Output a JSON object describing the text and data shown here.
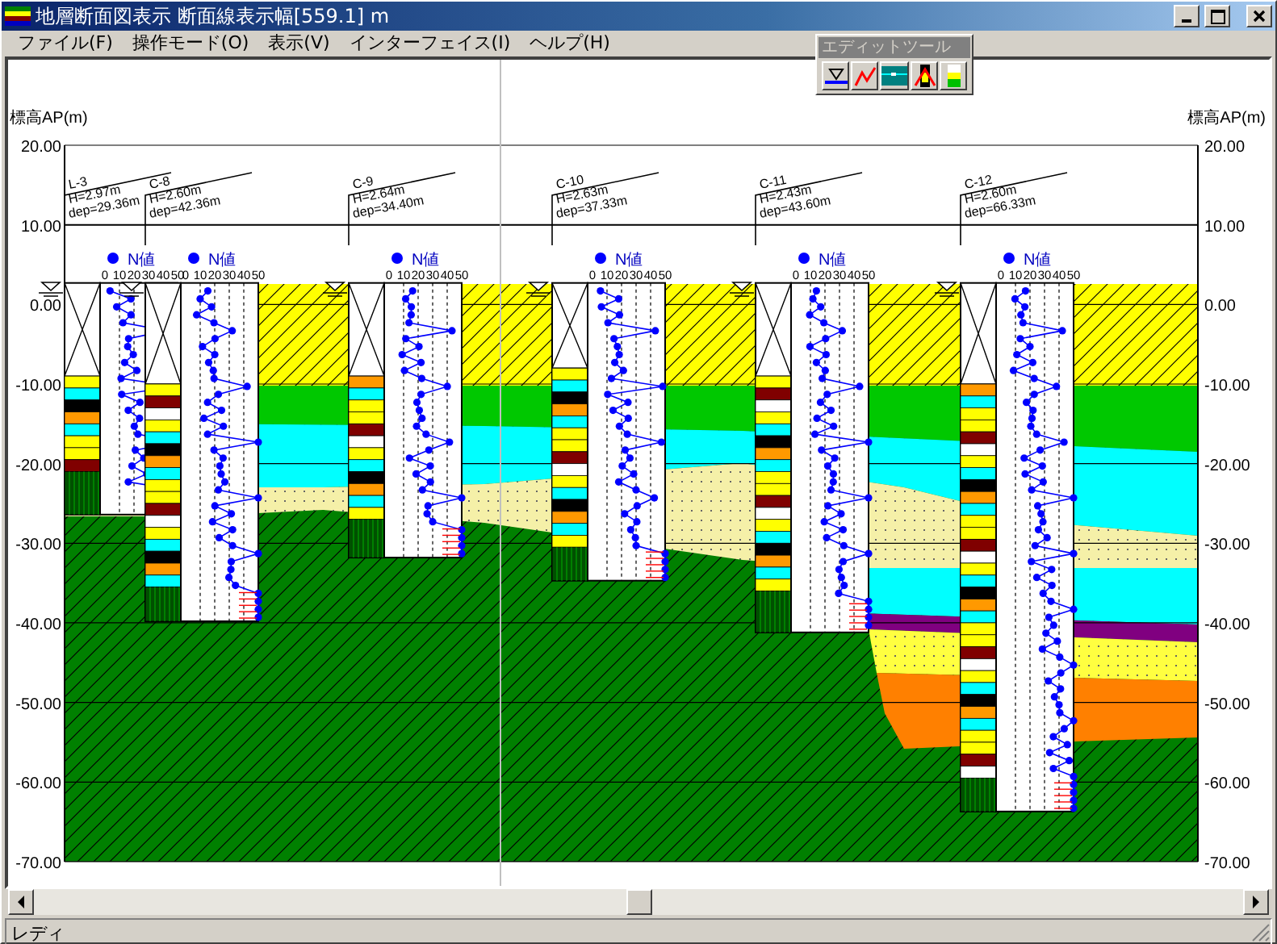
{
  "window": {
    "title": "地層断面図表示  断面線表示幅[559.1] m"
  },
  "menu": [
    "ファイル(F)",
    "操作モード(O)",
    "表示(V)",
    "インターフェイス(I)",
    "ヘルプ(H)"
  ],
  "tool_palette": {
    "title": "エディットツール"
  },
  "section": {
    "left_axis": {
      "label": "標高AP(m)",
      "ticks": [
        "20.00",
        "10.00",
        "0.00",
        "-10.00",
        "-20.00",
        "-30.00",
        "-40.00",
        "-50.00",
        "-60.00",
        "-70.00"
      ]
    },
    "right_axis": {
      "label": "標高AP(m)",
      "ticks": [
        "20.00",
        "10.00",
        "0.00",
        "-10.00",
        "-20.00",
        "-30.00",
        "-40.00",
        "-50.00",
        "-60.00",
        "-70.00"
      ]
    },
    "boreholes": [
      {
        "name": "L-3",
        "h": "H=2.97m",
        "dep": "dep=29.36m",
        "n_label": "N値",
        "n_ticks": [
          "0",
          "10",
          "20",
          "30",
          "40",
          "50"
        ]
      },
      {
        "name": "C-8",
        "h": "H=2.60m",
        "dep": "dep=42.36m",
        "n_label": "N値",
        "n_ticks": [
          "0",
          "10",
          "20",
          "30",
          "40",
          "50"
        ]
      },
      {
        "name": "C-9",
        "h": "H=2.64m",
        "dep": "dep=34.40m",
        "n_label": "N値",
        "n_ticks": [
          "0",
          "10",
          "20",
          "30",
          "40",
          "50"
        ]
      },
      {
        "name": "C-10",
        "h": "H=2.63m",
        "dep": "dep=37.33m",
        "n_label": "N値",
        "n_ticks": [
          "0",
          "10",
          "20",
          "30",
          "40",
          "50"
        ]
      },
      {
        "name": "C-11",
        "h": "H=2.43m",
        "dep": "dep=43.60m",
        "n_label": "N値",
        "n_ticks": [
          "0",
          "10",
          "20",
          "30",
          "40",
          "50"
        ]
      },
      {
        "name": "C-12",
        "h": "H=2.60m",
        "dep": "dep=66.33m",
        "n_label": "N値",
        "n_ticks": [
          "0",
          "10",
          "20",
          "30",
          "40",
          "50"
        ]
      }
    ]
  },
  "status_bar": {
    "text": "レディ"
  }
}
